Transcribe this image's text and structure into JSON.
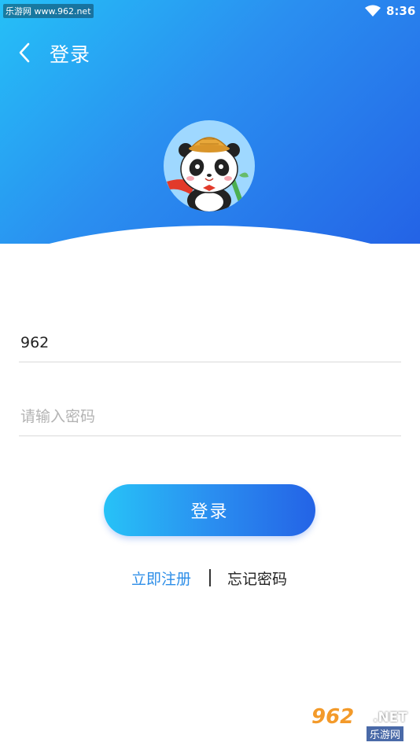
{
  "status_bar": {
    "watermark": "乐游网 www.962.net",
    "time": "8:36"
  },
  "header": {
    "title": "登录"
  },
  "form": {
    "username_value": "962",
    "password_placeholder": "请输入密码",
    "login_label": "登录"
  },
  "links": {
    "register": "立即注册",
    "forgot": "忘记密码"
  },
  "watermark_bottom": {
    "brand": "962",
    "net": ".NET",
    "site": "乐游网"
  },
  "colors": {
    "accent_start": "#25c0f7",
    "accent_end": "#2463e6",
    "link": "#2d8ee8"
  }
}
